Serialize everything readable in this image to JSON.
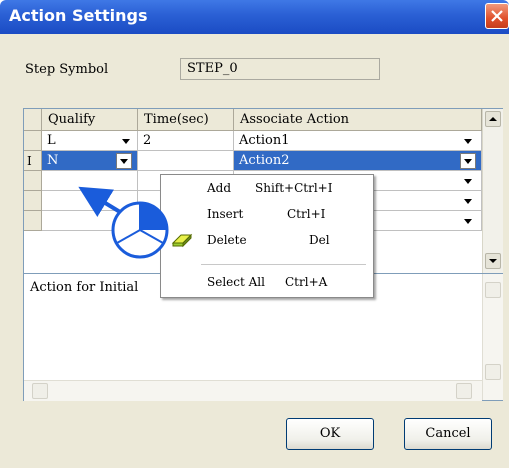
{
  "window": {
    "title": "Action Settings"
  },
  "step": {
    "label": "Step Symbol",
    "value": "STEP_0"
  },
  "table": {
    "columns": [
      "Qualify",
      "Time(sec)",
      "Associate Action"
    ],
    "rows": [
      {
        "marker": "",
        "qualify": "L",
        "time": "2",
        "action": "Action1"
      },
      {
        "marker": "I",
        "qualify": "N",
        "time": "",
        "action": "Action2"
      },
      {
        "marker": "",
        "qualify": "",
        "time": "",
        "action": ""
      },
      {
        "marker": "",
        "qualify": "",
        "time": "",
        "action": ""
      },
      {
        "marker": "",
        "qualify": "",
        "time": "",
        "action": ""
      }
    ]
  },
  "description": {
    "text": "Action for Initial"
  },
  "buttons": {
    "ok": "OK",
    "cancel": "Cancel"
  },
  "context_menu": {
    "items": [
      {
        "label": "Add",
        "shortcut": "Shift+Ctrl+I"
      },
      {
        "label": "Insert",
        "shortcut": "Ctrl+I"
      },
      {
        "label": "Delete",
        "shortcut": "Del",
        "icon": "eraser-icon"
      },
      {
        "label": "Select All",
        "shortcut": "Ctrl+A"
      }
    ]
  },
  "colors": {
    "selection": "#316ac5",
    "titlebar": "#2a5fd4",
    "callout": "#1a5cdb"
  }
}
